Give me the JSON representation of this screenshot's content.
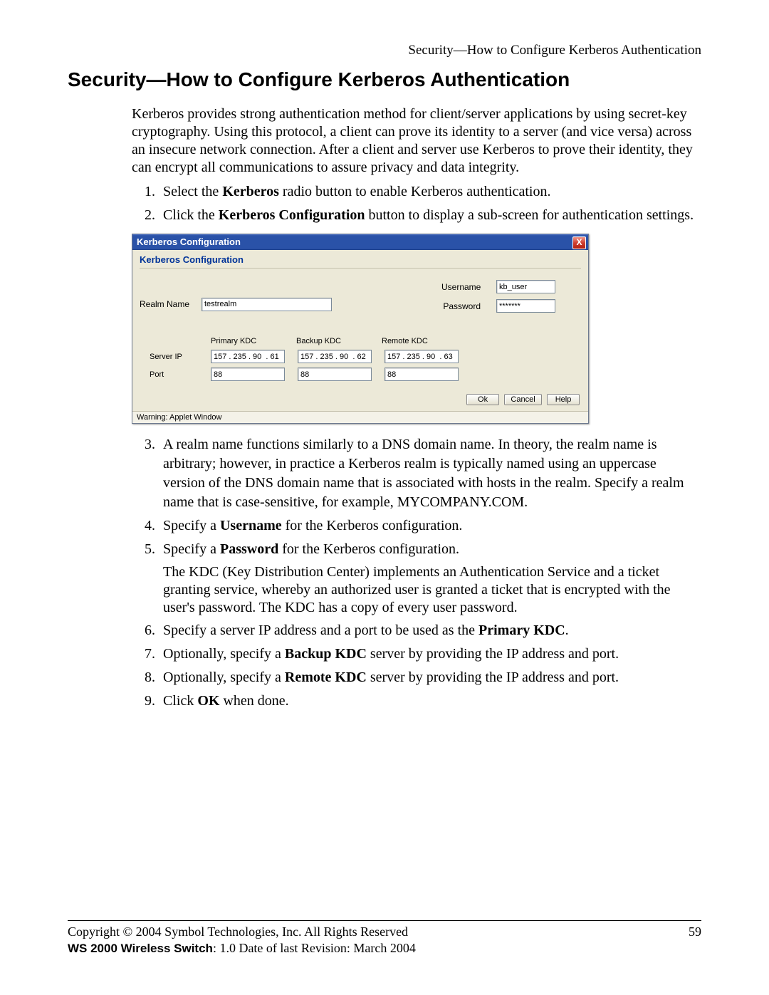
{
  "header": "Security—How to Configure Kerberos Authentication",
  "heading": "Security—How to Configure Kerberos Authentication",
  "intro": "Kerberos provides strong authentication method for client/server applications by using secret-key cryptography. Using this protocol, a client can prove its identity to a server (and vice versa) across an insecure network connection. After a client and server use Kerberos to prove their identity, they can encrypt all communications to assure privacy and data integrity.",
  "steps": {
    "s1a": "Select the ",
    "s1b": "Kerberos",
    "s1c": " radio button to enable Kerberos authentication.",
    "s2a": "Click the ",
    "s2b": "Kerberos Configuration",
    "s2c": " button to display a sub-screen for authentication settings.",
    "s3": "A realm name functions similarly to a DNS domain name. In theory, the realm name is arbitrary; however, in practice a Kerberos realm is typically named using an uppercase version of the DNS domain name that is associated with hosts in the realm. Specify a realm name that is case-sensitive, for example, MYCOMPANY.COM.",
    "s4a": "Specify a ",
    "s4b": "Username",
    "s4c": " for the Kerberos configuration.",
    "s5a": "Specify a ",
    "s5b": "Password",
    "s5c": " for the Kerberos configuration.",
    "kdc_note": "The KDC (Key Distribution Center) implements an Authentication Service and a ticket granting service, whereby an authorized user is granted a ticket that is encrypted with the user's password. The KDC has a copy of every user password.",
    "s6a": "Specify a server IP address and a port to be used as the ",
    "s6b": "Primary KDC",
    "s6c": ".",
    "s7a": "Optionally, specify a ",
    "s7b": "Backup KDC",
    "s7c": " server by providing the IP address and port.",
    "s8a": "Optionally, specify a ",
    "s8b": "Remote KDC",
    "s8c": " server by providing the IP address and port.",
    "s9a": "Click ",
    "s9b": "OK",
    "s9c": " when done."
  },
  "dialog": {
    "title": "Kerberos Configuration",
    "panel_title": "Kerberos Configuration",
    "labels": {
      "realm_name": "Realm Name",
      "username": "Username",
      "password": "Password",
      "primary_kdc": "Primary KDC",
      "backup_kdc": "Backup KDC",
      "remote_kdc": "Remote KDC",
      "server_ip": "Server IP",
      "port": "Port"
    },
    "values": {
      "realm_name": "testrealm",
      "username": "kb_user",
      "password": "*******",
      "primary_ip": "157 . 235 . 90  . 61",
      "backup_ip": "157 . 235 . 90  . 62",
      "remote_ip": "157 . 235 . 90  . 63",
      "primary_port": "88",
      "backup_port": "88",
      "remote_port": "88"
    },
    "buttons": {
      "ok": "Ok",
      "cancel": "Cancel",
      "help": "Help"
    },
    "statusbar": "Warning: Applet Window",
    "close": "X"
  },
  "footer": {
    "copyright": "Copyright © 2004 Symbol Technologies, Inc. All Rights Reserved",
    "product": "WS 2000 Wireless Switch",
    "version_line": ": 1.0  Date of last Revision: March 2004",
    "page": "59"
  }
}
